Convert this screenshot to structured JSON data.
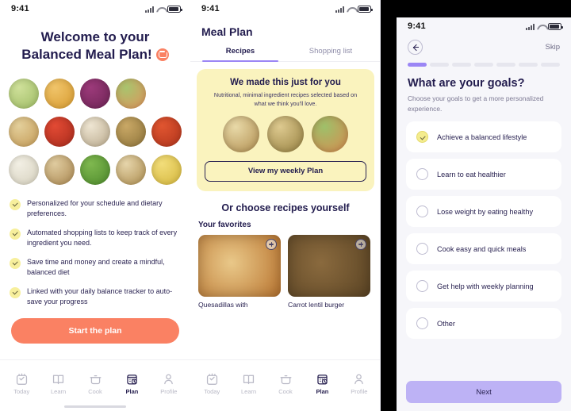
{
  "status_bar": {
    "time": "9:41",
    "icons": [
      "signal-icon",
      "wifi-icon",
      "battery-icon"
    ]
  },
  "colors": {
    "orange": "#FA8163",
    "purple": "#9B86F5",
    "purple_light": "#BDB2F5",
    "yellow_card": "#FAF3BE",
    "yellow_check": "#F4EC8E",
    "ink": "#221C4E",
    "page_bg": "#F6F6FA"
  },
  "panel1": {
    "title_line1": "Welcome to your",
    "title_line2": "Balanced Meal Plan!",
    "badge_icon": "cooking-pot-badge-icon",
    "features": [
      "Personalized for your schedule and dietary preferences.",
      "Automated shopping lists to keep track of every ingredient you need.",
      "Save time and money and create a mindful, balanced diet",
      "Linked with your daily balance tracker to auto-save your progress"
    ],
    "cta_label": "Start the plan",
    "food_grid": [
      {
        "name": "avocado-half",
        "c1": "#cfe09a",
        "c2": "#9dbb63",
        "shape": "round"
      },
      {
        "name": "curry-soup-bowl",
        "c1": "#f0c46a",
        "c2": "#d79a2e",
        "shape": "round"
      },
      {
        "name": "red-onion",
        "c1": "#9c3a7a",
        "c2": "#6d2455",
        "shape": "round"
      },
      {
        "name": "salmon-salad-bowl",
        "c1": "#a8c46e",
        "c2": "#e0925a",
        "shape": "round"
      },
      {
        "name": "empty-slot",
        "c1": "#ffffff",
        "c2": "#ffffff",
        "shape": "none"
      },
      {
        "name": "chicken-rice-bowl",
        "c1": "#e3cf9b",
        "c2": "#c49a55",
        "shape": "round"
      },
      {
        "name": "cherry-tomatoes",
        "c1": "#e24a34",
        "c2": "#a82b1c",
        "shape": "round"
      },
      {
        "name": "oatmeal-berries-bowl",
        "c1": "#eee5d2",
        "c2": "#b9a98c",
        "shape": "round"
      },
      {
        "name": "falafel-ball",
        "c1": "#c9a866",
        "c2": "#8d7339",
        "shape": "round"
      },
      {
        "name": "tomato-soup-bowl",
        "c1": "#e05530",
        "c2": "#b0341c",
        "shape": "round"
      },
      {
        "name": "white-cheese-wedge",
        "c1": "#f2efe4",
        "c2": "#d5d0bd",
        "shape": "round"
      },
      {
        "name": "stir-fry-bowl",
        "c1": "#dfcb9f",
        "c2": "#a9864f",
        "shape": "round"
      },
      {
        "name": "snap-peas",
        "c1": "#7fb84f",
        "c2": "#4d8a2c",
        "shape": "round"
      },
      {
        "name": "vegetable-rice-bowl",
        "c1": "#e6d5ab",
        "c2": "#ab8b4d",
        "shape": "round"
      },
      {
        "name": "bananas",
        "c1": "#f2dd7a",
        "c2": "#d4b63c",
        "shape": "round"
      }
    ],
    "tabs": [
      {
        "label": "Today",
        "icon": "calendar-check-icon",
        "active": false
      },
      {
        "label": "Learn",
        "icon": "open-book-icon",
        "active": false
      },
      {
        "label": "Cook",
        "icon": "cooking-pot-icon",
        "active": false
      },
      {
        "label": "Plan",
        "icon": "plan-grid-icon",
        "active": true
      },
      {
        "label": "Profile",
        "icon": "person-icon",
        "active": false
      }
    ]
  },
  "panel2": {
    "title": "Meal Plan",
    "tabs": [
      {
        "label": "Recipes",
        "active": true
      },
      {
        "label": "Shopping list",
        "active": false
      }
    ],
    "promo": {
      "heading": "We made this just for you",
      "subtext": "Nutritional, minimal ingredient recipes selected based on what we think you'll love.",
      "button_label": "View my weekly Plan",
      "images": [
        {
          "name": "veggie-rice-bowl-photo",
          "c1": "#e8d9a8",
          "c2": "#b08d4e"
        },
        {
          "name": "tofu-grain-bowl-photo",
          "c1": "#ddc98f",
          "c2": "#96803f"
        },
        {
          "name": "salmon-salad-bowl-photo",
          "c1": "#9ec06a",
          "c2": "#d98a4e"
        }
      ]
    },
    "choose_heading": "Or choose recipes yourself",
    "favorites_heading": "Your favorites",
    "favorites": [
      {
        "name": "Quesadillas with",
        "icon": "plus-icon",
        "c1": "#e9c889",
        "c2": "#b9742f"
      },
      {
        "name": "Carrot lentil burger",
        "icon": "plus-icon",
        "c1": "#8a6a3e",
        "c2": "#5b4424"
      }
    ],
    "tabs_bottom": [
      {
        "label": "Today",
        "icon": "calendar-check-icon",
        "active": false
      },
      {
        "label": "Learn",
        "icon": "open-book-icon",
        "active": false
      },
      {
        "label": "Cook",
        "icon": "cooking-pot-icon",
        "active": false
      },
      {
        "label": "Plan",
        "icon": "plan-grid-icon",
        "active": true
      },
      {
        "label": "Profile",
        "icon": "person-icon",
        "active": false
      }
    ]
  },
  "panel3": {
    "back_icon": "back-arrow-icon",
    "skip_label": "Skip",
    "progress": {
      "total": 7,
      "completed": 1
    },
    "question": "What are your goals?",
    "subtitle": "Choose your goals to get a more personalized experience.",
    "options": [
      {
        "label": "Achieve a balanced lifestyle",
        "selected": true
      },
      {
        "label": "Learn to eat healthier",
        "selected": false
      },
      {
        "label": "Lose weight by eating healthy",
        "selected": false
      },
      {
        "label": "Cook easy and quick meals",
        "selected": false
      },
      {
        "label": "Get help with weekly planning",
        "selected": false
      },
      {
        "label": "Other",
        "selected": false
      }
    ],
    "next_label": "Next"
  }
}
